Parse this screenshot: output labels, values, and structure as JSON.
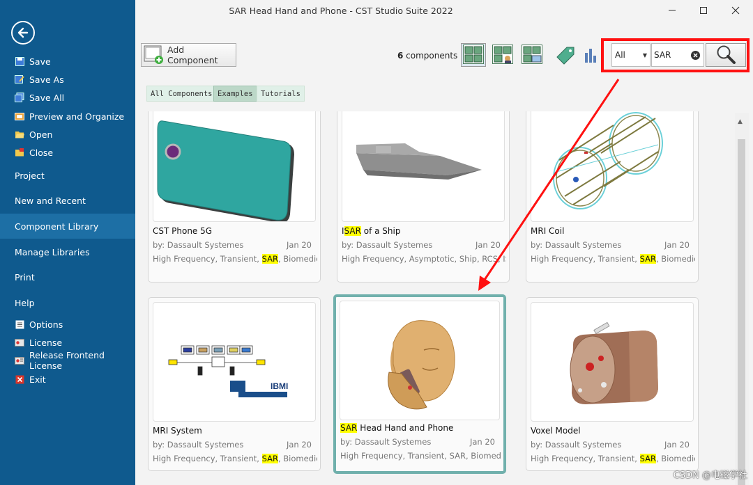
{
  "window": {
    "title": "SAR Head Hand and Phone - CST Studio Suite 2022"
  },
  "sidebar": {
    "items": [
      {
        "label": "Save",
        "icon": "save-icon"
      },
      {
        "label": "Save As",
        "icon": "save-as-icon"
      },
      {
        "label": "Save All",
        "icon": "save-all-icon"
      },
      {
        "label": "Preview and Organize",
        "icon": "preview-icon"
      },
      {
        "label": "Open",
        "icon": "folder-open-icon"
      },
      {
        "label": "Close",
        "icon": "folder-close-icon"
      }
    ],
    "sections": [
      {
        "label": "Project"
      },
      {
        "label": "New and Recent"
      },
      {
        "label": "Component Library",
        "active": true
      },
      {
        "label": "Manage Libraries"
      },
      {
        "label": "Print"
      },
      {
        "label": "Help"
      }
    ],
    "bottom_items": [
      {
        "label": "Options",
        "icon": "options-icon"
      },
      {
        "label": "License",
        "icon": "license-icon"
      },
      {
        "label": "Release Frontend License",
        "icon": "release-license-icon"
      },
      {
        "label": "Exit",
        "icon": "exit-icon"
      }
    ]
  },
  "toolbar": {
    "add_component_label": "Add Component",
    "count_number": "6",
    "count_suffix": " components",
    "filter_value": "All",
    "search_value": "SAR"
  },
  "tabs": [
    {
      "label": "All Components"
    },
    {
      "label": "Examples",
      "selected": true
    },
    {
      "label": "Tutorials"
    }
  ],
  "cards": [
    {
      "name_pre": "",
      "name_hl": "",
      "name_post": "CST Phone 5G",
      "author": "by: Dassault Systemes",
      "date": "Jan 20",
      "tags_pre": "High Frequency, Transient, ",
      "tags_hl": "SAR",
      "tags_post": ", Biomedic..."
    },
    {
      "name_pre": "I",
      "name_hl": "SAR",
      "name_post": " of a Ship",
      "author": "by: Dassault Systemes",
      "date": "Jan 20",
      "tags_pre": "High Frequency, Asymptotic, Ship, RCS, IS",
      "tags_hl": "",
      "tags_post": ""
    },
    {
      "name_pre": "",
      "name_hl": "",
      "name_post": "MRI Coil",
      "author": "by: Dassault Systemes",
      "date": "Jan 20",
      "tags_pre": "High Frequency, Transient, ",
      "tags_hl": "SAR",
      "tags_post": ", Biomedic..."
    },
    {
      "name_pre": "",
      "name_hl": "",
      "name_post": "MRI System",
      "author": "by: Dassault Systemes",
      "date": "Jan 20",
      "tags_pre": "High Frequency, Transient, ",
      "tags_hl": "SAR",
      "tags_post": ", Biomedic..."
    },
    {
      "name_pre": "",
      "name_hl": "SAR",
      "name_post": " Head Hand and Phone",
      "author": "by: Dassault Systemes",
      "date": "Jan 20",
      "tags_pre": "High Frequency, Transient, SAR, Biomedic...",
      "tags_hl": "",
      "tags_post": ""
    },
    {
      "name_pre": "",
      "name_hl": "",
      "name_post": "Voxel Model",
      "author": "by: Dassault Systemes",
      "date": "Jan 20",
      "tags_pre": "High Frequency, Transient, ",
      "tags_hl": "SAR",
      "tags_post": ", Biomedical"
    }
  ],
  "mri_system_thumb": {
    "logo_text": "IBMI"
  },
  "watermark": "CSDN @电磁学社",
  "colors": {
    "sidebar": "#0f5a8e",
    "highlight": "#ffff00",
    "annotation_red": "#ff1111",
    "selected_border": "#70b0ac"
  }
}
